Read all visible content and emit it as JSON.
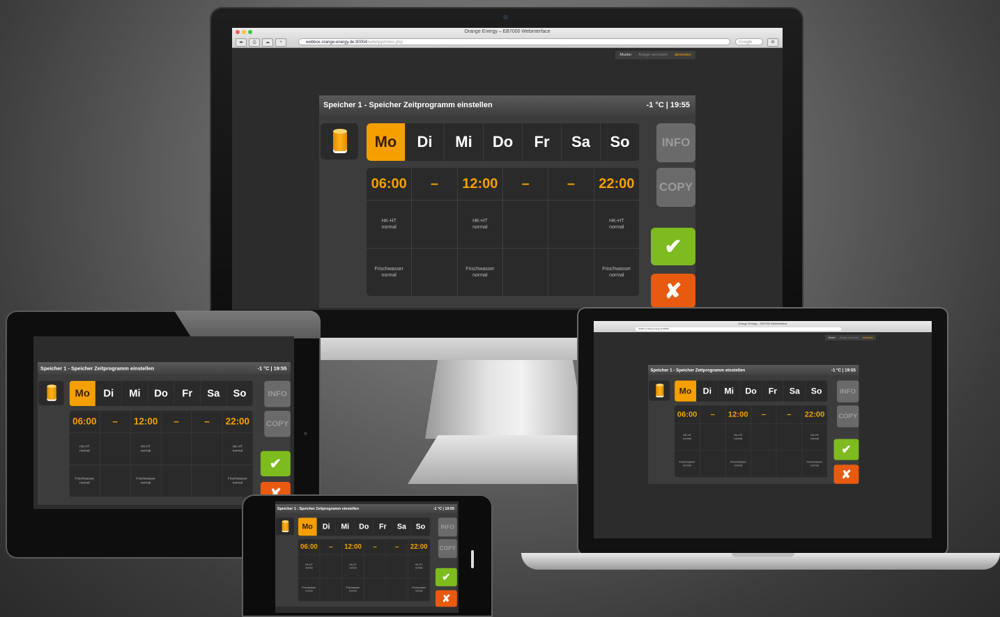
{
  "browser": {
    "window_title": "Orange Energy – EB7000 Webinterface",
    "url_host": "webbox.orange-energy.de:30004",
    "url_path": "/webApp/index.php",
    "search_placeholder": "Google"
  },
  "top_menu": {
    "item_1": "Muster",
    "item_2": "Anlage wechseln",
    "item_3": "abmelden"
  },
  "app": {
    "title": "Speicher 1 - Speicher Zeitprogramm einstellen",
    "status": "-1 °C | 19:55",
    "days": [
      "Mo",
      "Di",
      "Mi",
      "Do",
      "Fr",
      "Sa",
      "So"
    ],
    "active_day": "Mo",
    "times": [
      "06:00",
      "–",
      "12:00",
      "–",
      "–",
      "22:00"
    ],
    "row1": [
      {
        "l1": "HK-HT",
        "l2": "normal"
      },
      {
        "l1": "",
        "l2": ""
      },
      {
        "l1": "HK-HT",
        "l2": "normal"
      },
      {
        "l1": "",
        "l2": ""
      },
      {
        "l1": "",
        "l2": ""
      },
      {
        "l1": "HK-HT",
        "l2": "normal"
      }
    ],
    "row2": [
      {
        "l1": "Frischwasser",
        "l2": "normal"
      },
      {
        "l1": "",
        "l2": ""
      },
      {
        "l1": "Frischwasser",
        "l2": "normal"
      },
      {
        "l1": "",
        "l2": ""
      },
      {
        "l1": "",
        "l2": ""
      },
      {
        "l1": "Frischwasser",
        "l2": "normal"
      }
    ],
    "buttons": {
      "info": "INFO",
      "copy": "COPY",
      "ok": "✔",
      "cancel": "✘"
    },
    "tank_icon": "storage-tank-icon"
  },
  "colors": {
    "accent_orange": "#f5a000",
    "ok_green": "#7dbb1e",
    "cancel_red": "#e85a10",
    "panel_dark": "#2a2a2a"
  }
}
